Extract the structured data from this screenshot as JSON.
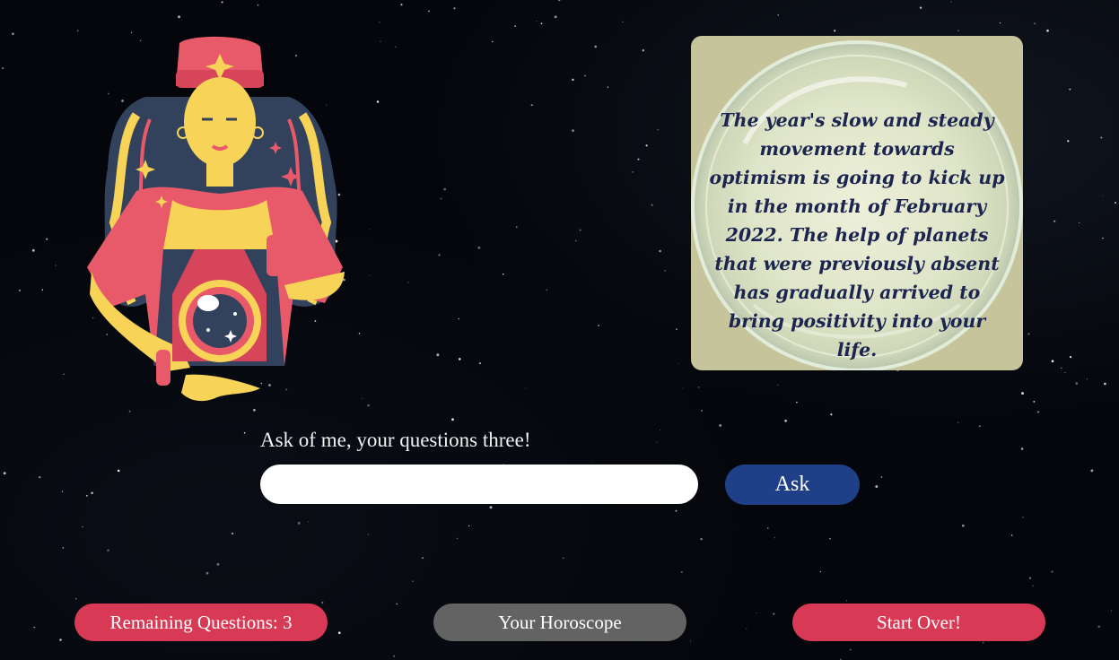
{
  "answer": {
    "text": "The year's slow and steady movement towards optimism is going to kick up in the month of February 2022. The help of planets that were previously absent has gradually arrived to bring positivity into your life."
  },
  "question": {
    "label": "Ask of me, your questions three!",
    "value": "",
    "placeholder": ""
  },
  "ask_button": {
    "label": "Ask"
  },
  "bottom_bar": {
    "remaining_label": "Remaining Questions: 3",
    "horoscope_label": "Your Horoscope",
    "start_over_label": "Start Over!"
  },
  "colors": {
    "background": "#05070c",
    "pink_button": "#d83a55",
    "grey_button": "#636363",
    "ask_button": "#1f4088",
    "answer_text": "#1c2450",
    "panel": "#c6c49a"
  },
  "icons": {
    "illustration": "fortune-teller-with-crystal-ball",
    "panel_background": "crystal-ball"
  }
}
